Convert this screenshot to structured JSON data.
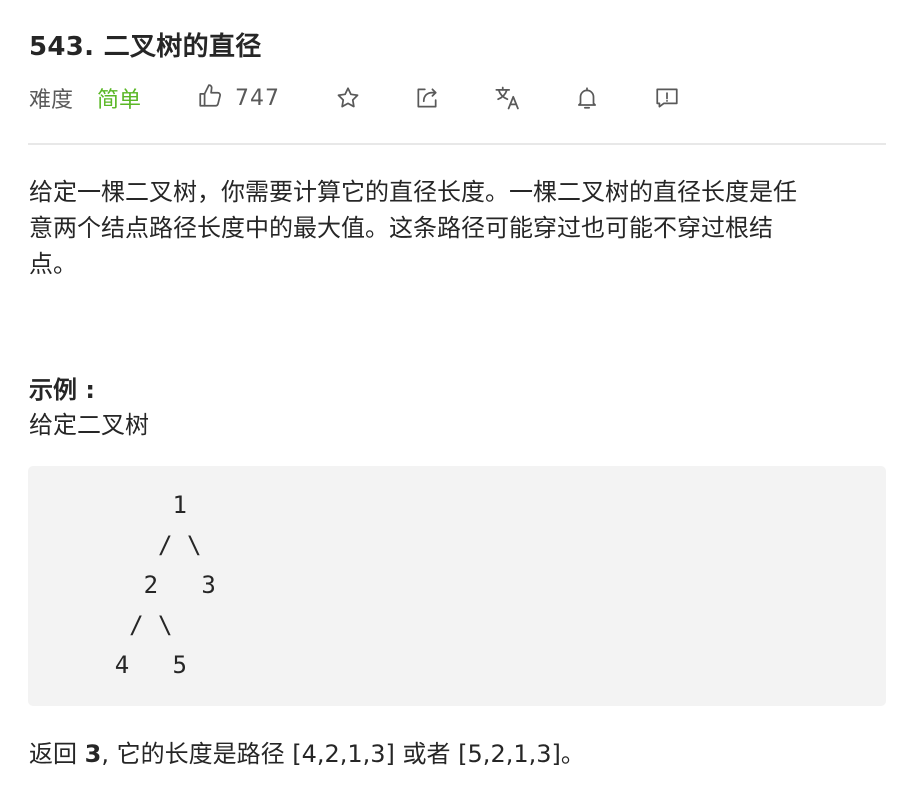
{
  "problem": {
    "title": "543. 二叉树的直径",
    "difficulty_label": "难度",
    "difficulty_value": "简单",
    "like_count": "747",
    "colors": {
      "difficulty": "#5ab726",
      "text": "#262626",
      "muted": "#595959",
      "code_bg": "#f3f3f3"
    },
    "icons": [
      "thumbs-up-icon",
      "star-icon",
      "share-icon",
      "translate-icon",
      "bell-icon",
      "feedback-icon"
    ]
  },
  "content": {
    "description_lines": [
      "给定一棵二叉树，你需要计算它的直径长度。一棵二叉树的直径长度是任",
      "意两个结点路径长度中的最大值。这条路径可能穿过也可能不穿过根结",
      "点。"
    ],
    "example_heading": "示例 :",
    "example_text": "给定二叉树",
    "code_lines": [
      "          1",
      "         / \\",
      "        2   3",
      "       / \\",
      "      4   5"
    ],
    "result": {
      "prefix": "返回 ",
      "value": "3",
      "suffix": ", 它的长度是路径 [4,2,1,3] 或者 [5,2,1,3]。"
    }
  }
}
